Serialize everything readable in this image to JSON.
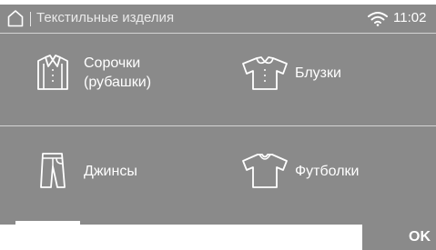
{
  "header": {
    "title": "Текстильные изделия",
    "time": "11:02"
  },
  "items": [
    {
      "label_line1": "Сорочки",
      "label_line2": "(рубашки)",
      "icon": "shirt-icon"
    },
    {
      "label_line1": "Блузки",
      "label_line2": "",
      "icon": "blouse-icon"
    },
    {
      "label_line1": "Джинсы",
      "label_line2": "",
      "icon": "jeans-icon"
    },
    {
      "label_line1": "Футболки",
      "label_line2": "",
      "icon": "tshirt-icon"
    }
  ],
  "footer": {
    "ok_label": "OK",
    "progress_fraction": 0.25
  },
  "colors": {
    "panel": "#8a8a8a",
    "text": "#ffffff",
    "divider": "#d4d4d4"
  }
}
